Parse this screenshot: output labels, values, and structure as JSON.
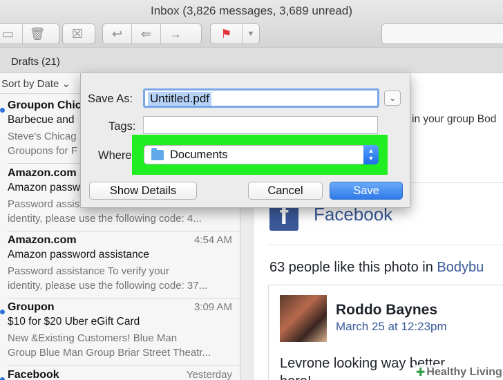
{
  "window": {
    "title": "Inbox (3,826 messages, 3,689 unread)"
  },
  "toolbar": {
    "icons": [
      "archive-icon",
      "trash-icon",
      "junk-icon",
      "reply-icon",
      "reply-all-icon",
      "forward-icon",
      "flag-icon",
      "chevron-down-icon"
    ]
  },
  "favorites": {
    "drafts": "Drafts (21)"
  },
  "message_list": {
    "sort_label": "Sort by Date ⌄",
    "messages": [
      {
        "sender": "Groupon Chic",
        "time": "",
        "subject": "Barbecue and",
        "preview1": "Steve's Chicag",
        "preview2": "Groupons for F",
        "unread": true
      },
      {
        "sender": "Amazon.com",
        "time": "",
        "subject": "Amazon passw",
        "preview1": "Password assista",
        "preview2": "identity, please use the following code: 4...",
        "unread": false
      },
      {
        "sender": "Amazon.com",
        "time": "4:54 AM",
        "subject": "Amazon password assistance",
        "preview1": "Password assistance To verify your",
        "preview2": "identity, please use the following code: 37...",
        "unread": false
      },
      {
        "sender": "Groupon",
        "time": "3:09 AM",
        "subject": "$10 for $20 Uber eGift Card",
        "preview1": "New &Existing Customers! Blue Man",
        "preview2": "Group Blue Man Group Briar Street Theatr...",
        "unread": true
      },
      {
        "sender": "Facebook",
        "time": "Yesterday",
        "subject": "",
        "preview1": "",
        "preview2": "",
        "unread": true
      }
    ]
  },
  "reader": {
    "top_text": "in your group Bod",
    "fb_logo": "f",
    "fb_name": "Facebook",
    "likes_text": "63 people like this photo in ",
    "likes_link": "Bodybu",
    "poster": "Roddo Baynes",
    "post_date": "March 25 at 12:23pm",
    "post_text_1": "Levrone looking way better",
    "post_text_2": "here!"
  },
  "dialog": {
    "save_as_label": "Save As:",
    "save_as_value": "Untitled.pdf",
    "tags_label": "Tags:",
    "where_label": "Where",
    "where_value": "Documents",
    "show_details": "Show Details",
    "cancel": "Cancel",
    "save": "Save",
    "highlight_color": "#21ee21",
    "accent_color": "#2f7ae8"
  },
  "watermark": {
    "text": "Healthy Living"
  }
}
